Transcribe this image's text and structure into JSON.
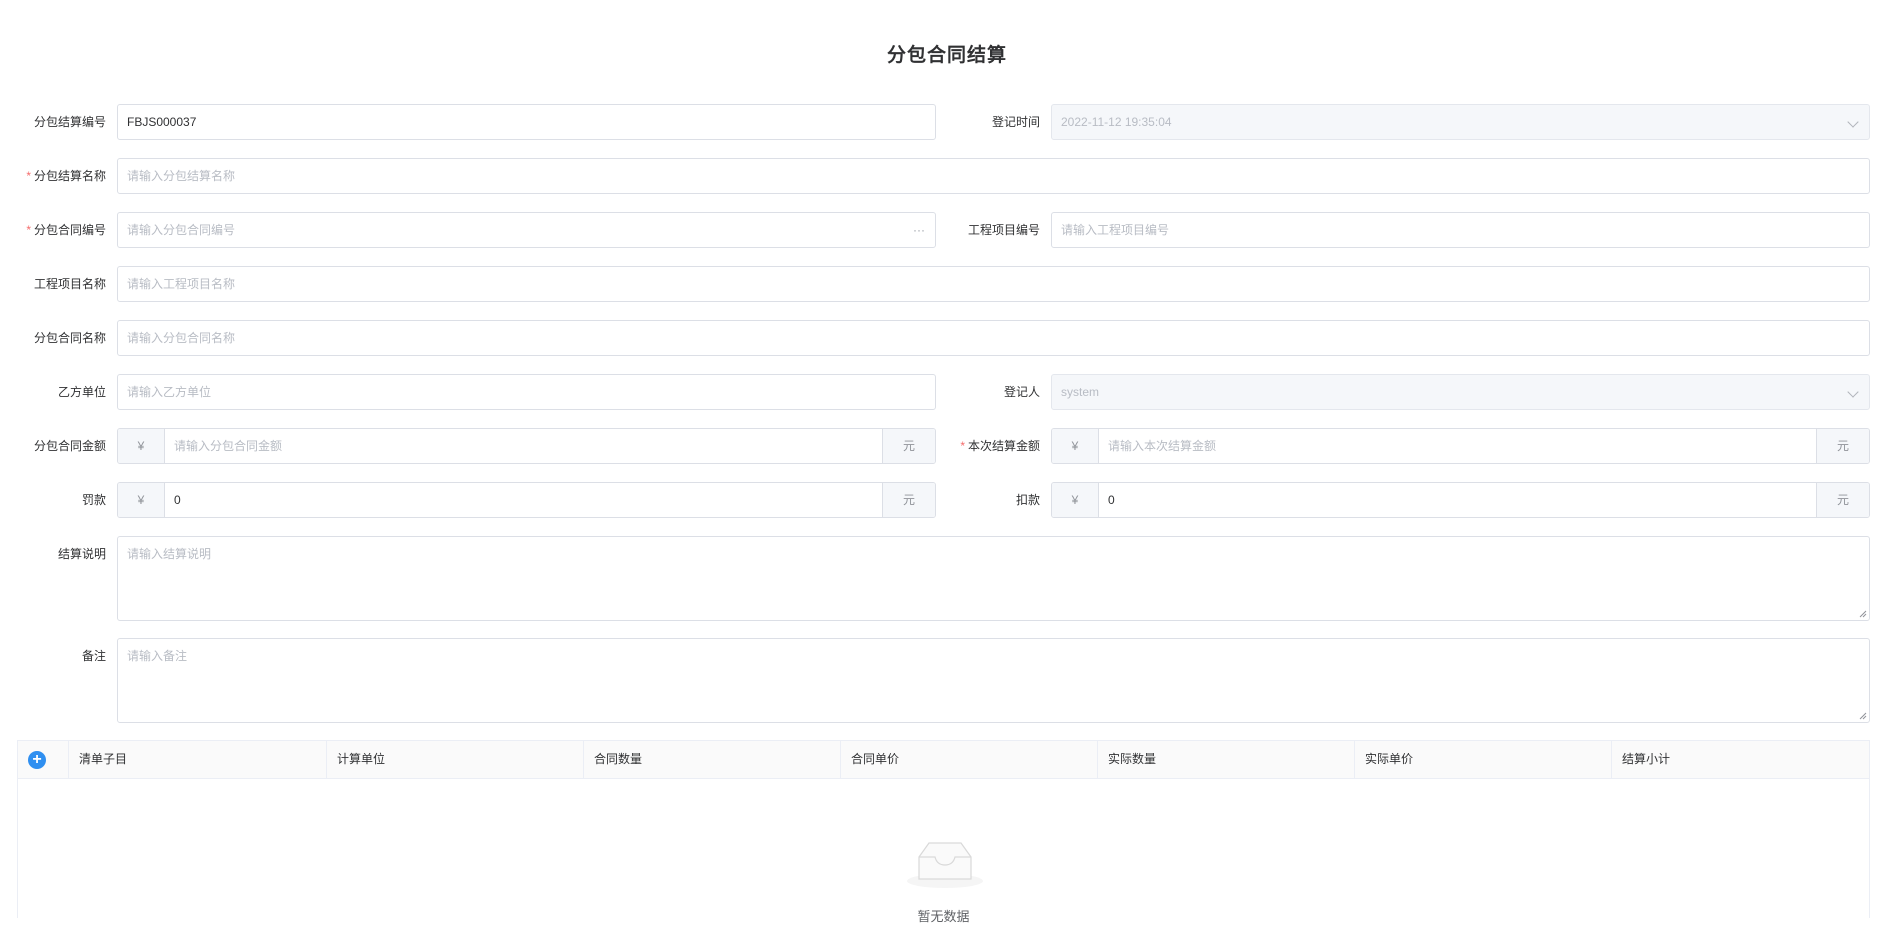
{
  "page_title": "分包合同结算",
  "form": {
    "settle_no": {
      "label": "分包结算编号",
      "value": "FBJS000037"
    },
    "reg_time": {
      "label": "登记时间",
      "value": "2022-11-12 19:35:04"
    },
    "settle_name": {
      "label": "分包结算名称",
      "required": "*",
      "placeholder": "请输入分包结算名称"
    },
    "contract_no": {
      "label": "分包合同编号",
      "required": "*",
      "placeholder": "请输入分包合同编号",
      "suffix": "···"
    },
    "project_no": {
      "label": "工程项目编号",
      "placeholder": "请输入工程项目编号"
    },
    "project_name": {
      "label": "工程项目名称",
      "placeholder": "请输入工程项目名称"
    },
    "contract_name": {
      "label": "分包合同名称",
      "placeholder": "请输入分包合同名称"
    },
    "party_b": {
      "label": "乙方单位",
      "placeholder": "请输入乙方单位"
    },
    "registrant": {
      "label": "登记人",
      "value": "system"
    },
    "contract_amount": {
      "label": "分包合同金额",
      "prefix": "¥",
      "placeholder": "请输入分包合同金额",
      "unit": "元"
    },
    "settle_amount": {
      "label": "本次结算金额",
      "required": "*",
      "prefix": "¥",
      "placeholder": "请输入本次结算金额",
      "unit": "元"
    },
    "penalty": {
      "label": "罚款",
      "prefix": "¥",
      "value": "0",
      "unit": "元"
    },
    "deduction": {
      "label": "扣款",
      "prefix": "¥",
      "value": "0",
      "unit": "元"
    },
    "description": {
      "label": "结算说明",
      "placeholder": "请输入结算说明"
    },
    "remark": {
      "label": "备注",
      "placeholder": "请输入备注"
    }
  },
  "table": {
    "add_icon": "plus-circle-icon",
    "columns": [
      "清单子目",
      "计算单位",
      "合同数量",
      "合同单价",
      "实际数量",
      "实际单价",
      "结算小计"
    ],
    "empty_text": "暂无数据"
  },
  "colors": {
    "accent": "#2f8ff0",
    "required": "#f56c6c",
    "border": "#dcdfe6"
  }
}
